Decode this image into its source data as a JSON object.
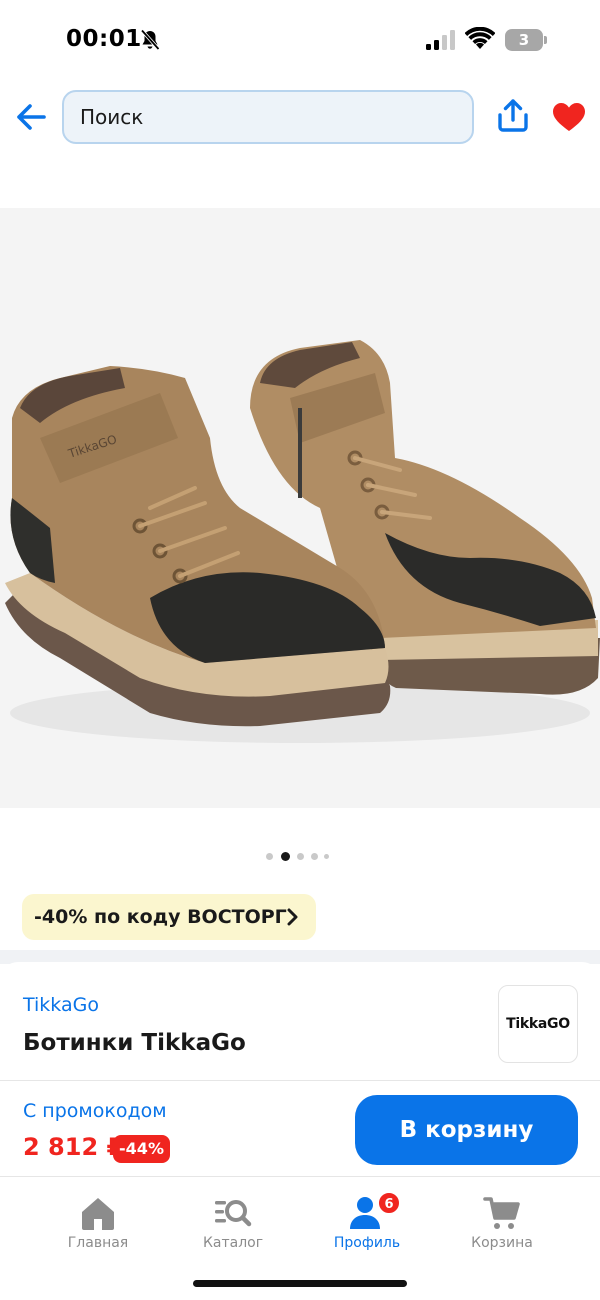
{
  "status_bar": {
    "time": "00:01",
    "battery": "3"
  },
  "top_nav": {
    "search_placeholder": "Поиск"
  },
  "product": {
    "image_alt": "Ботинки TikkaGo",
    "image_dots_count": 5,
    "image_dots_active_index": 1,
    "promo_text": "-40% по коду ВОСТОРГ",
    "brand": "TikkaGo",
    "title": "Ботинки TikkaGo",
    "brand_logo_text": "TikkaGO",
    "price_label": "С промокодом",
    "price": "2 812 ₽",
    "discount": "-44%",
    "cart_button": "В корзину"
  },
  "tab_bar": {
    "tabs": [
      {
        "label": "Главная",
        "icon": "home-icon"
      },
      {
        "label": "Каталог",
        "icon": "catalog-search-icon"
      },
      {
        "label": "Профиль",
        "icon": "profile-icon",
        "badge": "6",
        "active": true
      },
      {
        "label": "Корзина",
        "icon": "cart-icon"
      }
    ]
  },
  "colors": {
    "accent": "#0a74e8",
    "price_red": "#f0251f",
    "promo_bg": "#fbf6cf"
  }
}
